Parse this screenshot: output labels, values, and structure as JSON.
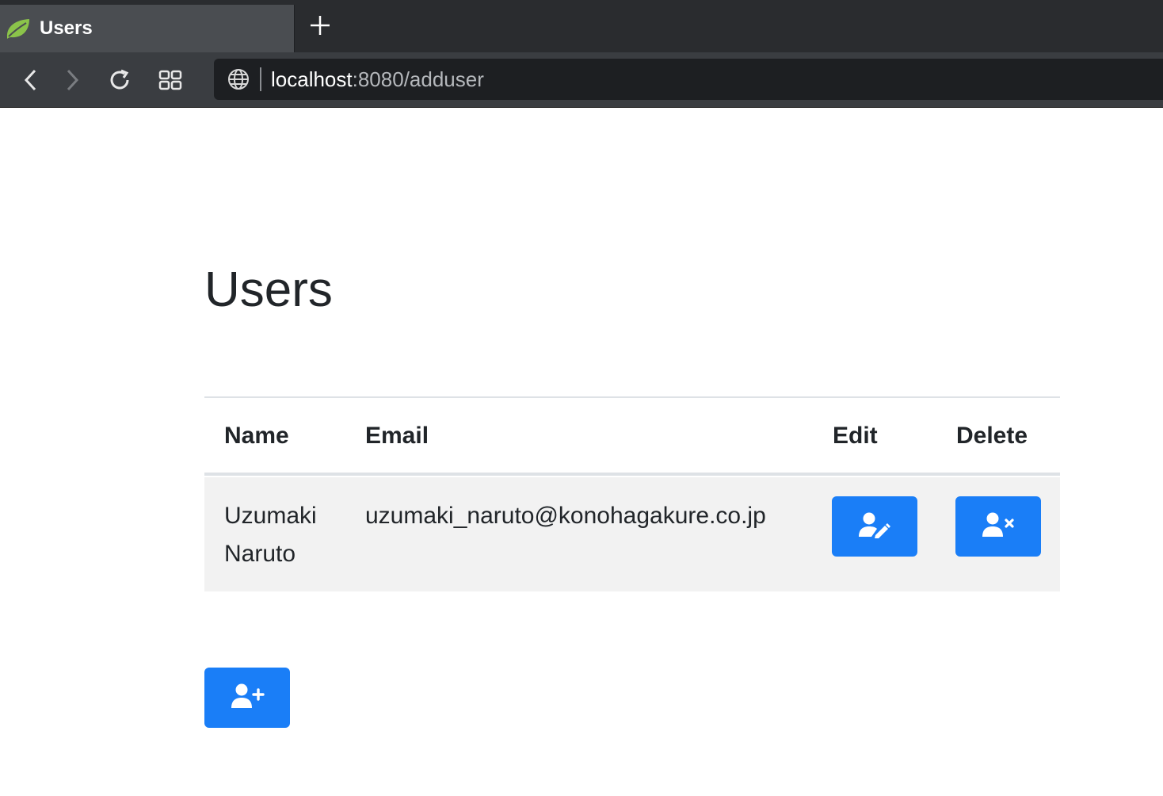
{
  "browser": {
    "tab_title": "Users",
    "url_host": "localhost",
    "url_rest": ":8080/adduser",
    "icons": {
      "favicon": "spring-leaf-icon",
      "new_tab": "plus-icon",
      "back": "chevron-left-icon",
      "forward": "chevron-right-icon",
      "reload": "reload-icon",
      "tabs": "tabs-grid-icon",
      "site": "globe-icon"
    }
  },
  "page": {
    "title": "Users",
    "table": {
      "headers": [
        "Name",
        "Email",
        "Edit",
        "Delete"
      ],
      "rows": [
        {
          "name": "Uzumaki Naruto",
          "email": "uzumaki_naruto@konohagakure.co.jp"
        }
      ]
    },
    "icons": {
      "edit": "user-edit-icon",
      "delete": "user-remove-icon",
      "add": "user-add-icon"
    }
  },
  "colors": {
    "accent": "#1a7ef7",
    "row_bg": "#f2f2f2",
    "text": "#212529"
  }
}
